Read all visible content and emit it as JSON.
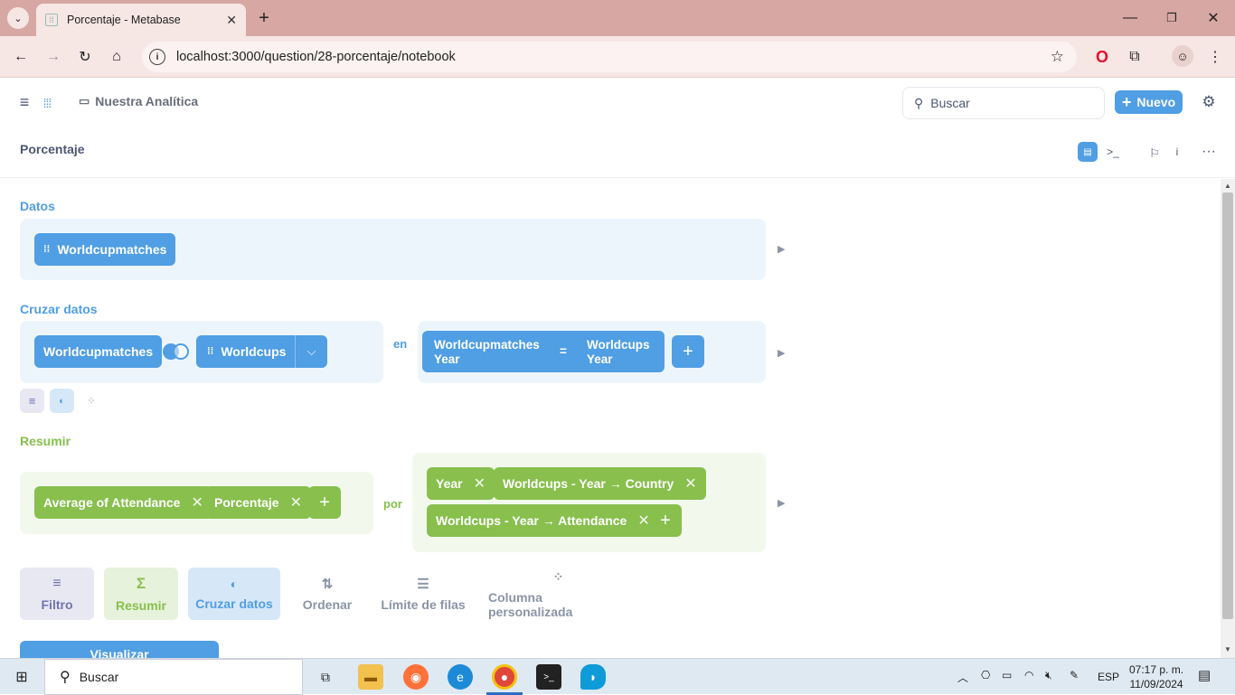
{
  "browser": {
    "tab_title": "Porcentaje - Metabase",
    "url": "localhost:3000/question/28-porcentaje/notebook"
  },
  "nav": {
    "collection": "Nuestra Analítica",
    "search_placeholder": "Buscar",
    "new_label": "Nuevo"
  },
  "question": {
    "title": "Porcentaje"
  },
  "data_step": {
    "label": "Datos",
    "table": "Worldcupmatches"
  },
  "join_step": {
    "label": "Cruzar datos",
    "left_table": "Worldcupmatches",
    "right_table": "Worldcups",
    "on_label": "en",
    "left_column_1": "Worldcupmatches",
    "left_column_2": "Year",
    "operator": "=",
    "right_column_1": "Worldcups",
    "right_column_2": "Year"
  },
  "summarize_step": {
    "label": "Resumir",
    "metrics": [
      "Average of Attendance",
      "Porcentaje"
    ],
    "by_label": "por",
    "breakouts": [
      "Year",
      "Worldcups - Year → Country",
      "Worldcups - Year → Attendance"
    ]
  },
  "actions": {
    "filter": "Filtro",
    "summarize": "Resumir",
    "join": "Cruzar datos",
    "sort": "Ordenar",
    "limit": "Límite de filas",
    "custom_column": "Columna personalizada",
    "visualize": "Visualizar"
  },
  "taskbar": {
    "search": "Buscar",
    "lang": "ESP",
    "time": "07:17 p. m.",
    "date": "11/09/2024"
  },
  "colors": {
    "brand": "#509ee3",
    "summarize": "#88bf4d",
    "filter": "#7172ad"
  }
}
